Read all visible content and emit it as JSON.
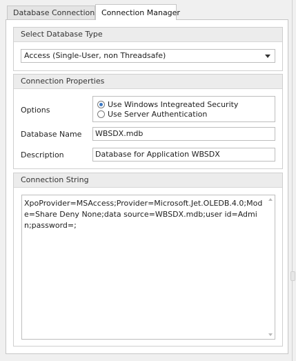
{
  "tabs": [
    {
      "label": "Database Connections",
      "selected": false
    },
    {
      "label": "Connection Manager",
      "selected": true
    }
  ],
  "db_type_group": {
    "header": "Select Database Type",
    "selected_value": "Access (Single-User, non Threadsafe)"
  },
  "conn_props": {
    "header": "Connection Properties",
    "options_label": "Options",
    "radio_options": [
      {
        "label": "Use Windows Integreated Security",
        "checked": true
      },
      {
        "label": "Use Server Authentication",
        "checked": false
      }
    ],
    "database_name_label": "Database Name",
    "database_name_value": "WBSDX.mdb",
    "description_label": "Description",
    "description_value": "Database for Application WBSDX"
  },
  "conn_string": {
    "header": "Connection String",
    "value": "XpoProvider=MSAccess;Provider=Microsoft.Jet.OLEDB.4.0;Mode=Share Deny None;data source=WBSDX.mdb;user id=Admin;password=;"
  },
  "icons": {
    "dropdown": "chevron-down-icon",
    "scroll_up": "scroll-up-arrow-icon",
    "scroll_down": "scroll-down-arrow-icon"
  },
  "colors": {
    "accent_radio": "#3a78c4",
    "group_header_bg": "#ececec",
    "border": "#bdbdbd"
  }
}
